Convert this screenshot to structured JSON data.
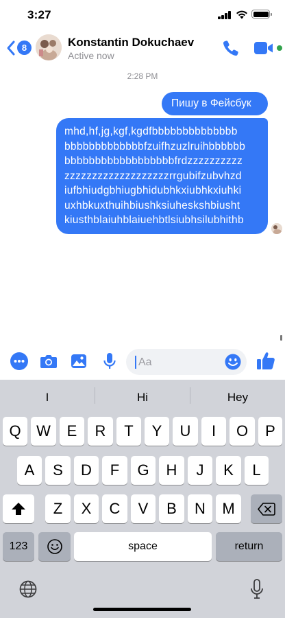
{
  "status_bar": {
    "time": "3:27"
  },
  "header": {
    "back_badge": "8",
    "contact_name": "Konstantin Dokuchaev",
    "contact_status": "Active now"
  },
  "messages": {
    "timestamp": "2:28 PM",
    "bubble_1": "Пишу в Фейсбук",
    "bubble_2_lines": [
      "mhd,hf,jg,kgf,kgdfbbbbbbbbbbbbbb",
      "bbbbbbbbbbbbbfzuifhzuzlruihbbbbbb",
      "bbbbbbbbbbbbbbbbbbfrdzzzzzzzzzz",
      "zzzzzzzzzzzzzzzzzzzrrgubifzubvhzd",
      "iufbhiudgbhiugbhidubhkxiubhkxiuhki",
      "uxhbkuxthuihbiushksiuheskshbiusht",
      "kiusthblaiuhblaiuehbtlsiubhsilubhithb"
    ]
  },
  "composer": {
    "placeholder": "Aa"
  },
  "keyboard": {
    "suggestions": [
      "I",
      "Hi",
      "Hey"
    ],
    "row1": [
      "Q",
      "W",
      "E",
      "R",
      "T",
      "Y",
      "U",
      "I",
      "O",
      "P"
    ],
    "row2": [
      "A",
      "S",
      "D",
      "F",
      "G",
      "H",
      "J",
      "K",
      "L"
    ],
    "row3": [
      "Z",
      "X",
      "C",
      "V",
      "B",
      "N",
      "M"
    ],
    "numbers_label": "123",
    "space_label": "space",
    "return_label": "return"
  },
  "colors": {
    "accent": "#3478f6",
    "online": "#31a24c",
    "keyboard_bg": "#d1d3d9"
  },
  "icons": [
    "back-chevron-icon",
    "phone-icon",
    "video-camera-icon",
    "more-icon",
    "camera-icon",
    "gallery-icon",
    "microphone-icon",
    "emoji-icon",
    "thumbs-up-icon",
    "shift-icon",
    "backspace-icon",
    "emoji-keyboard-icon",
    "globe-icon",
    "dictation-microphone-icon"
  ]
}
